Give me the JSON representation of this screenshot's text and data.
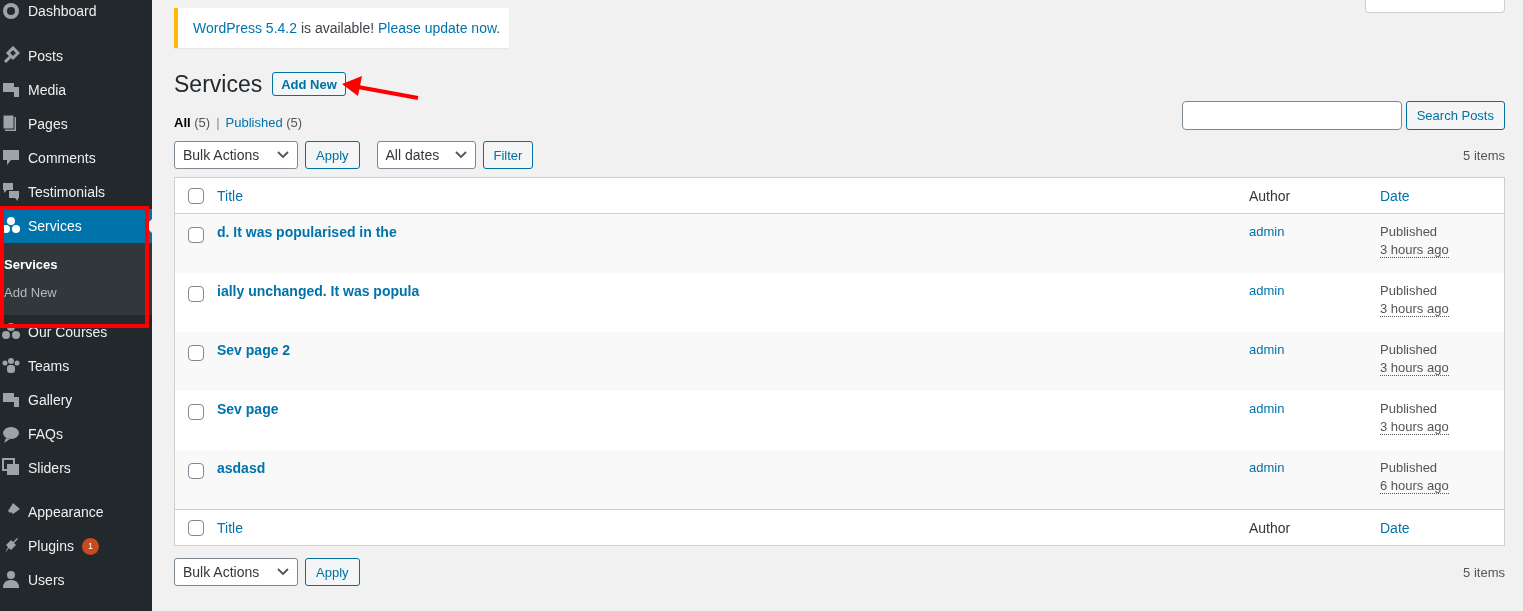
{
  "sidebar": {
    "groups": [
      [
        {
          "label": "Dashboard",
          "selected": false
        }
      ],
      [
        {
          "label": "Posts",
          "selected": false
        },
        {
          "label": "Media",
          "selected": false
        },
        {
          "label": "Pages",
          "selected": false
        },
        {
          "label": "Comments",
          "selected": false
        },
        {
          "label": "Testimonials",
          "selected": false
        },
        {
          "label": "Services",
          "selected": true,
          "submenu": [
            {
              "label": "Services",
              "selected": true
            },
            {
              "label": "Add New",
              "selected": false
            }
          ]
        },
        {
          "label": "Our Courses",
          "selected": false
        },
        {
          "label": "Teams",
          "selected": false
        },
        {
          "label": "Gallery",
          "selected": false
        },
        {
          "label": "FAQs",
          "selected": false
        },
        {
          "label": "Sliders",
          "selected": false
        }
      ],
      [
        {
          "label": "Appearance",
          "selected": false
        },
        {
          "label": "Plugins",
          "selected": false,
          "badge": "1"
        },
        {
          "label": "Users",
          "selected": false
        }
      ]
    ]
  },
  "notice": {
    "link": "WordPress 5.4.2",
    "text": " is available! ",
    "action": "Please update now",
    "end": "."
  },
  "page": {
    "title": "Services",
    "add_new": "Add New"
  },
  "views": [
    {
      "label": "All",
      "count": "(5)",
      "selected": true
    },
    {
      "label": "Published",
      "count": "(5)",
      "selected": false
    }
  ],
  "views_separator": "|",
  "search": {
    "button": "Search Posts"
  },
  "tablenav_top": {
    "bulk": "Bulk Actions",
    "apply": "Apply",
    "dates": "All dates",
    "filter": "Filter",
    "count": "5 items"
  },
  "table": {
    "columns": [
      {
        "label": "Title",
        "sortable": true
      },
      {
        "label": "Author",
        "sortable": false
      },
      {
        "label": "Date",
        "sortable": true
      }
    ],
    "header_checked": false,
    "rows": [
      {
        "title": "d. It was popularised in the",
        "author": "admin",
        "status": "Published",
        "time": "3 hours ago",
        "checked": false
      },
      {
        "title": "ially unchanged. It was popula",
        "author": "admin",
        "status": "Published",
        "time": "3 hours ago",
        "checked": false
      },
      {
        "title": "Sev page 2",
        "author": "admin",
        "status": "Published",
        "time": "3 hours ago",
        "checked": false
      },
      {
        "title": "Sev page",
        "author": "admin",
        "status": "Published",
        "time": "3 hours ago",
        "checked": false
      },
      {
        "title": "asdasd",
        "author": "admin",
        "status": "Published",
        "time": "6 hours ago",
        "checked": false
      }
    ],
    "footer_columns": [
      {
        "label": "Title",
        "sortable": true
      },
      {
        "label": "Author",
        "sortable": false
      },
      {
        "label": "Date",
        "sortable": true
      }
    ],
    "footer_checked": false
  },
  "tablenav_bottom": {
    "bulk": "Bulk Actions",
    "apply": "Apply",
    "count": "5 items"
  }
}
